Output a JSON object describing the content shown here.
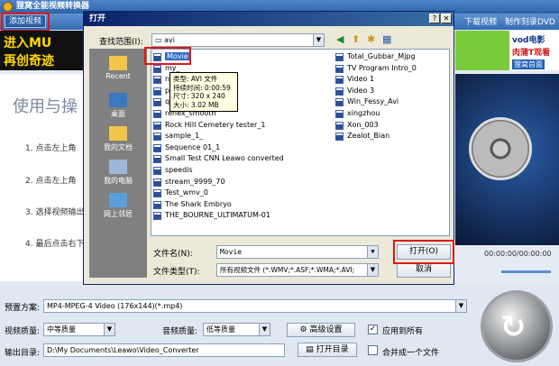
{
  "app": {
    "title": "狸窝全能视频转换器",
    "add_video_label": "添加视频",
    "toolbar_right": [
      "下载视频",
      "制作刻录DVD"
    ],
    "banner": {
      "line1": "进入MU",
      "line2": "再创奇迹"
    },
    "ad": {
      "name": "vod电影",
      "sub": "肉蒲T观看",
      "badge": "狸窝首面"
    },
    "instructions": {
      "title": "使用与操",
      "steps": [
        "1. 点击左上角",
        "2. 点击左上角",
        "3. 选择视频输出",
        "4. 最后点击右下"
      ]
    },
    "time_readout": "00:00:00/00:00:00",
    "bottom": {
      "preset_label": "预置方案:",
      "preset_value": "MP4-MPEG-4 Video (176x144)(*.mp4)",
      "video_quality_label": "视频质量:",
      "video_quality_value": "中等质量",
      "audio_quality_label": "音频质量:",
      "audio_quality_value": "低等质量",
      "advanced_label": "高级设置",
      "apply_all_label": "应用到所有",
      "output_label": "输出目录:",
      "output_value": "D:\\My Documents\\Leawo\\Video_Converter",
      "open_dir_label": "打开目录",
      "merge_label": "合并成一个文件"
    }
  },
  "dialog": {
    "title": "打开",
    "lookin_label": "查找范围(I):",
    "lookin_value": "avi",
    "places": [
      "Recent",
      "桌面",
      "我的文档",
      "我的电脑",
      "网上邻居"
    ],
    "files_col1": [
      "Movie",
      "my_",
      "not",
      "play",
      "quick",
      "renex_smooth",
      "Rock Hill Cemetery tester_1",
      "sample_1_",
      "Sequence 01_1",
      "Small Test CNN Leawo converted",
      "speedis",
      "stream_9999_70",
      "Test_wmv_0",
      "The Shark Embryo",
      "THE_BOURNE_ULTIMATUM-01"
    ],
    "files_col2": [
      "Total_Gubbar_Mjpg",
      "TV Program Intro_0",
      "Video 1",
      "Video 3",
      "Win_Fessy_Avi",
      "xingzhou",
      "Xon_003",
      "Zealot_Bian"
    ],
    "tooltip": [
      "类型: AVI 文件",
      "持续时间: 0:00:59",
      "尺寸: 320 x 240",
      "大小: 3.02 MB"
    ],
    "filename_label": "文件名(N):",
    "filename_value": "Movie",
    "filetype_label": "文件类型(T):",
    "filetype_value": "所有视频文件 (*.WMV;*.ASF;*.WMA;*.AVI;",
    "open_label": "打开(O)",
    "cancel_label": "取消"
  }
}
